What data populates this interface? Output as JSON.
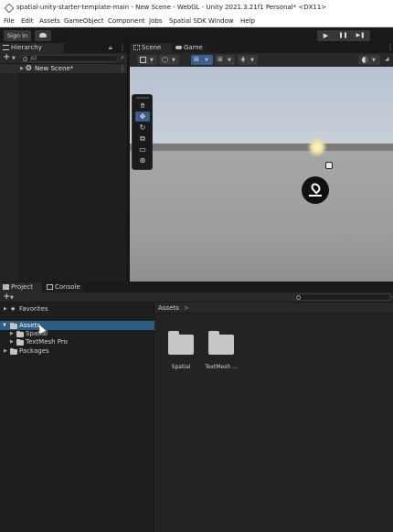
{
  "window": {
    "title": "spatial-unity-starter-template-main - New Scene - WebGL - Unity 2021.3.21f1 Personal* <DX11>"
  },
  "menu": [
    "File",
    "Edit",
    "Assets",
    "GameObject",
    "Component",
    "Jobs",
    "Spatial SDK",
    "Window",
    "Help"
  ],
  "toolbar": {
    "sign_in": "Sign in",
    "play": "▶",
    "pause": "❚❚",
    "step": "▶❚"
  },
  "hierarchy": {
    "tab": "Hierarchy",
    "plus": "+",
    "search_placeholder": "All",
    "items": [
      {
        "label": "New Scene*",
        "icon": "unity-scene-icon"
      }
    ]
  },
  "scene": {
    "tabs": [
      {
        "label": "Scene",
        "icon": "grid-icon"
      },
      {
        "label": "Game",
        "icon": "gamepad-icon"
      }
    ],
    "tools": [
      "hand-tool-icon",
      "move-tool-icon",
      "rotate-tool-icon",
      "scale-tool-icon",
      "rect-tool-icon",
      "transform-tool-icon"
    ],
    "selected_tool": "move-tool-icon"
  },
  "project": {
    "tabs": [
      {
        "label": "Project",
        "icon": "folder-icon"
      },
      {
        "label": "Console",
        "icon": "console-icon"
      }
    ],
    "plus": "+",
    "tree": [
      {
        "label": "Favorites",
        "type": "star",
        "level": 0
      },
      {
        "label": "Assets",
        "type": "folder",
        "level": 0,
        "selected": true
      },
      {
        "label": "Spatial",
        "type": "folder",
        "level": 1
      },
      {
        "label": "TextMesh Pro",
        "type": "folder",
        "level": 1
      },
      {
        "label": "Packages",
        "type": "folder",
        "level": 0
      }
    ],
    "breadcrumb": "Assets",
    "breadcrumb_sep": ">",
    "grid": [
      {
        "label": "Spatial"
      },
      {
        "label": "TextMesh ..."
      }
    ]
  }
}
